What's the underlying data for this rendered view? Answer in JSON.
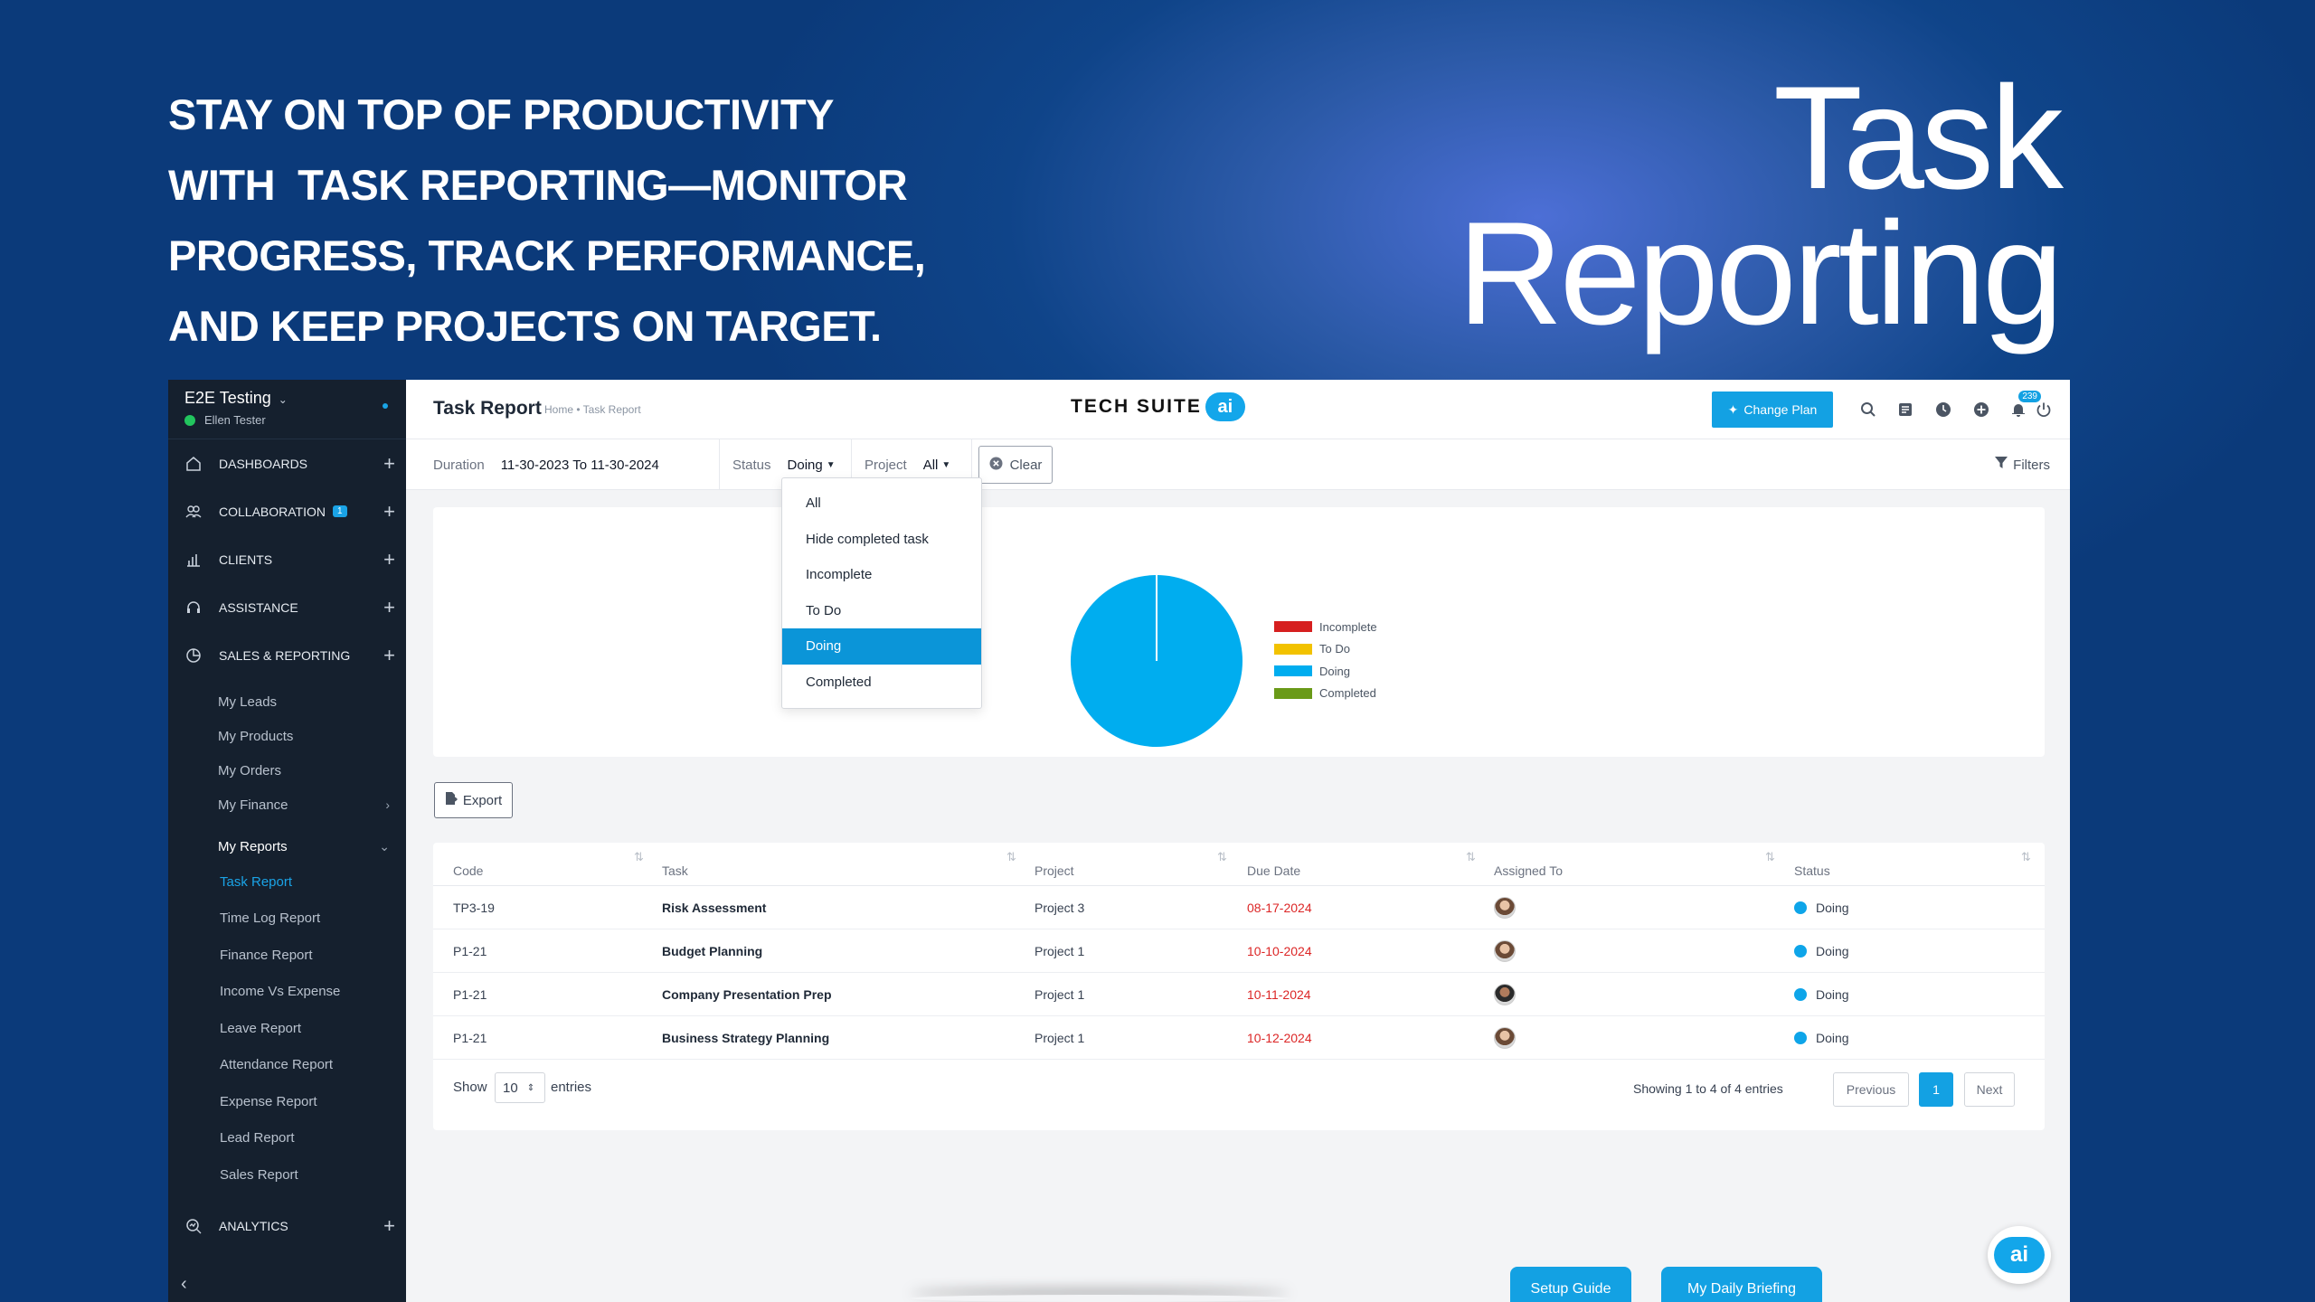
{
  "hero": {
    "lines": [
      "STAY ON TOP OF PRODUCTIVITY",
      "WITH  TASK REPORTING—MONITOR",
      "PROGRESS, TRACK PERFORMANCE,",
      "AND KEEP PROJECTS ON TARGET."
    ],
    "title_line1": "Task",
    "title_line2": "Reporting"
  },
  "sidebar": {
    "workspace": "E2E Testing",
    "user": "Ellen Tester",
    "nav": [
      {
        "label": "DASHBOARDS",
        "icon": "home-icon"
      },
      {
        "label": "COLLABORATION",
        "icon": "users-icon",
        "badge": "1"
      },
      {
        "label": "CLIENTS",
        "icon": "bar-chart-icon"
      },
      {
        "label": "ASSISTANCE",
        "icon": "headset-icon"
      },
      {
        "label": "SALES & REPORTING",
        "icon": "pie-chart-icon"
      }
    ],
    "sub": [
      "My Leads",
      "My Products",
      "My Orders",
      "My Finance",
      "My Reports"
    ],
    "reports": [
      "Task Report",
      "Time Log Report",
      "Finance Report",
      "Income Vs Expense",
      "Leave Report",
      "Attendance Report",
      "Expense Report",
      "Lead Report",
      "Sales Report"
    ],
    "analytics": "ANALYTICS"
  },
  "header": {
    "title": "Task Report",
    "breadcrumb": "Home • Task Report",
    "logo_text": "TECH SUITE",
    "logo_ai": "ai",
    "change_plan": "Change Plan",
    "notification_count": "239"
  },
  "filters": {
    "duration_label": "Duration",
    "duration_value": "11-30-2023 To 11-30-2024",
    "status_label": "Status",
    "status_value": "Doing",
    "project_label": "Project",
    "project_value": "All",
    "clear": "Clear",
    "filters": "Filters"
  },
  "status_options": [
    "All",
    "Hide completed task",
    "Incomplete",
    "To Do",
    "Doing",
    "Completed"
  ],
  "chart_data": {
    "type": "pie",
    "categories": [
      "Incomplete",
      "To Do",
      "Doing",
      "Completed"
    ],
    "values": [
      0,
      0,
      4,
      0
    ],
    "colors": [
      "#d61f1f",
      "#f2c200",
      "#00adef",
      "#6a9a18"
    ],
    "legend": "right"
  },
  "export_label": "Export",
  "table": {
    "columns": [
      "Code",
      "Task",
      "Project",
      "Due Date",
      "Assigned To",
      "Status"
    ],
    "rows": [
      {
        "code": "TP3-19",
        "task": "Risk Assessment",
        "project": "Project 3",
        "due": "08-17-2024",
        "status": "Doing"
      },
      {
        "code": "P1-21",
        "task": "Budget Planning",
        "project": "Project 1",
        "due": "10-10-2024",
        "status": "Doing"
      },
      {
        "code": "P1-21",
        "task": "Company Presentation Prep",
        "project": "Project 1",
        "due": "10-11-2024",
        "status": "Doing"
      },
      {
        "code": "P1-21",
        "task": "Business Strategy Planning",
        "project": "Project 1",
        "due": "10-12-2024",
        "status": "Doing"
      }
    ],
    "show_label": "Show",
    "page_size": "10",
    "entries_label": "entries",
    "showing": "Showing 1 to 4 of 4 entries",
    "previous": "Previous",
    "current_page": "1",
    "next": "Next"
  },
  "buttons": {
    "setup_guide": "Setup Guide",
    "daily_briefing": "My Daily Briefing",
    "ai_fab": "ai"
  }
}
